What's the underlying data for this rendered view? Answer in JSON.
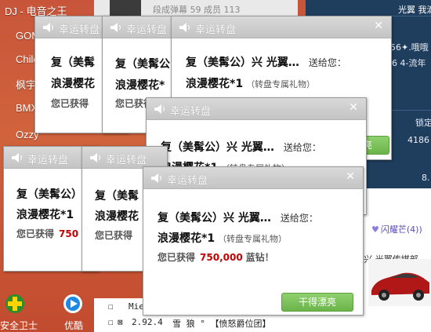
{
  "left_list": [
    "DJ - 电音之王",
    "GOM",
    "Child",
    "枫宇网",
    "BMX",
    "Ozzy"
  ],
  "bg_strip_text": "段成弹幕  59  成员  113",
  "right_panel": {
    "user": "光翼 我滴",
    "row1": "56✦.哦哦",
    "row2": "6 4-流年",
    "lock": "锁定",
    "num1": "4186",
    "num2": "8."
  },
  "right_white": {
    "tag": "闪耀芒(4))",
    "line2": ")兴  光翼传媒部"
  },
  "bottom_icons": {
    "security": "安全卫士",
    "app2": "优酷"
  },
  "bottom_bar": {
    "line1": "Mie",
    "line2_num": "2.92.4",
    "line2_rest": "雪  狼  ° 【愤怒爵位团】"
  },
  "popup": {
    "title": "幸运转盘",
    "sender": "复（美髯公）兴  光翼…",
    "send_to": "送给您：",
    "gift_name": "浪漫樱花*1",
    "gift_note": "（转盘专属礼物）",
    "earned_label": "您已获得",
    "earned_amount": "750,000",
    "earned_unit": "蓝钻！",
    "ok_button": "干得漂亮"
  },
  "partials": {
    "p1_sender": "复（美髯",
    "p1_gift": "浪漫樱花",
    "p1_earned": "您已获得",
    "p2_sender": "复（美髯公",
    "p2_gift": "浪漫樱花*",
    "p2_earned": "您已获得",
    "p3_cut": "您已获得  750,000 蓝钻",
    "p5_sender": "复（美髯公）",
    "p5_gift": "浪漫樱花*1",
    "p5_earned": "您已获得",
    "p5_amount": "750",
    "p6_sender": "复（美髯",
    "p6_gift": "浪漫樱花",
    "p6_earned": "您已获得"
  }
}
